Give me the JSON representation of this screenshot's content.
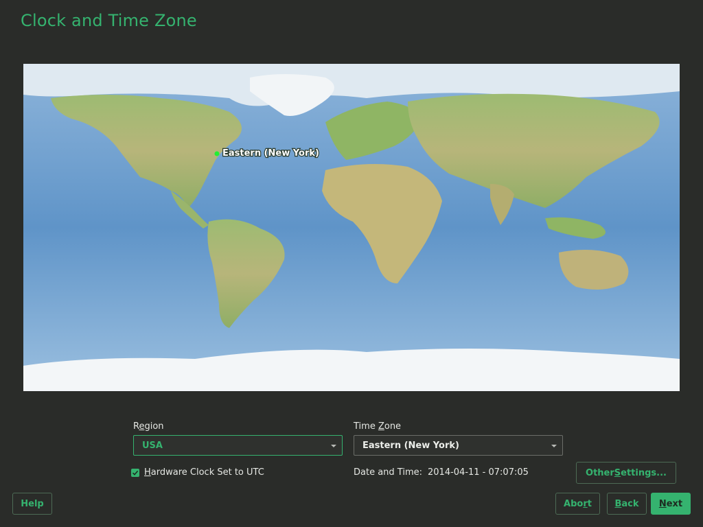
{
  "page_title": "Clock and Time Zone",
  "map": {
    "selected_label": "Eastern (New York)",
    "marker_color": "#22ee33",
    "ocean_color": "#6f9fcf",
    "land_color": "#9fb874",
    "ice_color": "#eef2f5"
  },
  "region": {
    "label_pre": "R",
    "label_u": "e",
    "label_post": "gion",
    "value": "USA"
  },
  "time_zone": {
    "label_pre": "Time ",
    "label_u": "Z",
    "label_post": "one",
    "value": "Eastern (New York)"
  },
  "hardware_clock": {
    "label_u": "H",
    "label_post": "ardware Clock Set to UTC",
    "checked": true
  },
  "date_time": {
    "label": "Date and Time:",
    "value": "2014-04-11 - 07:07:05"
  },
  "buttons": {
    "other_settings_pre": "Other ",
    "other_settings_u": "S",
    "other_settings_post": "ettings...",
    "help": "Help",
    "abort_pre": "Abo",
    "abort_u": "r",
    "abort_post": "t",
    "back_u": "B",
    "back_post": "ack",
    "next_u": "N",
    "next_post": "ext"
  },
  "colors": {
    "accent": "#35b36f",
    "background": "#2a2c29"
  },
  "icons": {
    "checkbox": "check-icon",
    "dropdown": "chevron-down-icon",
    "marker": "location-marker-icon"
  }
}
